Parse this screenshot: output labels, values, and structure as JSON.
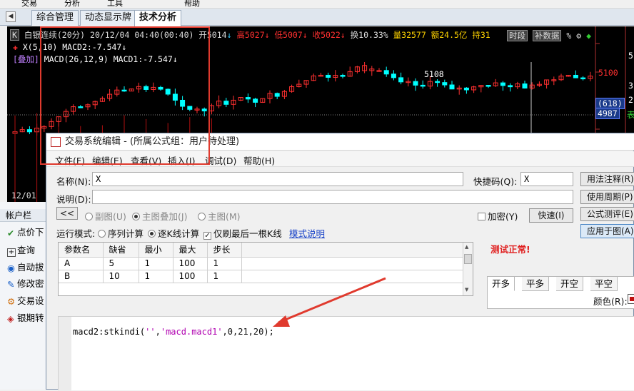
{
  "topbar": {
    "items": [
      "交易",
      "分析",
      "工具",
      "帮助"
    ]
  },
  "tabs": [
    {
      "label": "综合管理",
      "active": false
    },
    {
      "label": "动态显示牌",
      "active": false
    },
    {
      "label": "技术分析",
      "active": true
    }
  ],
  "chart": {
    "header": {
      "badge": "K",
      "name": "白银连续(20分)",
      "datetime": "20/12/04 04:40(00:40)",
      "open": "开5014",
      "high": "高5027",
      "low": "低5007",
      "close": "收5022",
      "turnover": "换10.33%",
      "volume": "量32577",
      "amount": "额24.5亿",
      "position": "持31",
      "btn_timeframe": "时段",
      "btn_supplement": "补数据",
      "percent": "%"
    },
    "line2": "X(5,10) MACD2:-7.547",
    "line3_prefix": "[叠加]",
    "line3": "MACD(26,12,9) MACD1:-7.547",
    "peak_label": "5108",
    "date_label": "12/01",
    "axis_price": "5100",
    "side_values": [
      "(618)",
      "4987"
    ],
    "far_right": [
      "5",
      "3",
      "2",
      "表"
    ],
    "colors": {
      "up": "#ff3030",
      "down": "#00ffff",
      "bg": "#000000",
      "text": "#c0c0c0"
    }
  },
  "left_panel": {
    "title": "帐户栏",
    "items": [
      {
        "icon": "check-icon",
        "label": "点价下"
      },
      {
        "icon": "plus-box-icon",
        "label": "查询"
      },
      {
        "icon": "auto-icon",
        "label": "自动拔"
      },
      {
        "icon": "edit-icon",
        "label": "修改密"
      },
      {
        "icon": "gear-icon",
        "label": "交易设"
      },
      {
        "icon": "bank-icon",
        "label": "银期转"
      }
    ]
  },
  "dialog": {
    "title": "交易系统编辑 - (所属公式组：用户待处理)",
    "menu": [
      "文件(F)",
      "编辑(E)",
      "查看(V)",
      "插入(I)",
      "调试(D)",
      "帮助(H)"
    ],
    "name_label": "名称(N):",
    "name_value": "X",
    "shortcut_label": "快捷码(Q):",
    "shortcut_value": "X",
    "desc_label": "说明(D):",
    "desc_value": "",
    "back_button": "<<",
    "chart_types": [
      "副图(U)",
      "主图叠加(J)",
      "主图(M)"
    ],
    "encrypt_label": "加密(Y)",
    "speed_button": "快速(I)",
    "run_mode_label": "运行模式:",
    "run_modes": [
      "序列计算",
      "逐K线计算"
    ],
    "last_bar_label": "仅刷最后一根K线",
    "mode_link": "模式说明",
    "right_buttons": [
      "用法注释(R)",
      "使用周期(P)",
      "公式测评(E)",
      "应用于图(A)"
    ],
    "status": "测试正常!",
    "params": {
      "columns": [
        "参数名",
        "缺省",
        "最小",
        "最大",
        "步长"
      ],
      "rows": [
        [
          "A",
          "5",
          "1",
          "100",
          "1"
        ],
        [
          "B",
          "10",
          "1",
          "100",
          "1"
        ]
      ]
    },
    "signal_tabs": [
      "开多",
      "平多",
      "开空",
      "平空"
    ],
    "color_label": "颜色(R):",
    "code": {
      "fn": "macd2:stkindi(",
      "arg1": "''",
      "sep1": ",",
      "arg2": "'macd.macd1'",
      "rest": ",0,21,20);"
    }
  }
}
